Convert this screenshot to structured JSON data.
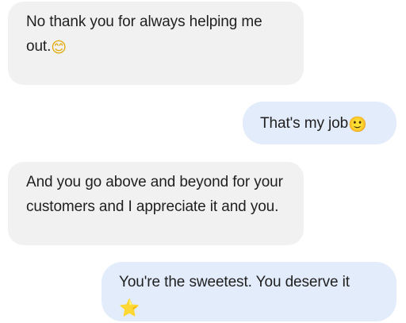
{
  "conversation": {
    "messages": [
      {
        "sender": "other",
        "text": "No thank you for always helping me out.",
        "emoji": "😊"
      },
      {
        "sender": "me",
        "text": "That's my job",
        "emoji": "🙂"
      },
      {
        "sender": "other",
        "text": "And you go above and beyond for your customers and I appreciate it and you.",
        "emoji": ""
      },
      {
        "sender": "me",
        "text": "You're the sweetest. You deserve it",
        "emoji": "⭐"
      }
    ]
  },
  "colors": {
    "incoming_bubble": "#f1f1f1",
    "outgoing_bubble": "#e3ecfb",
    "text": "#1f1f1f"
  }
}
